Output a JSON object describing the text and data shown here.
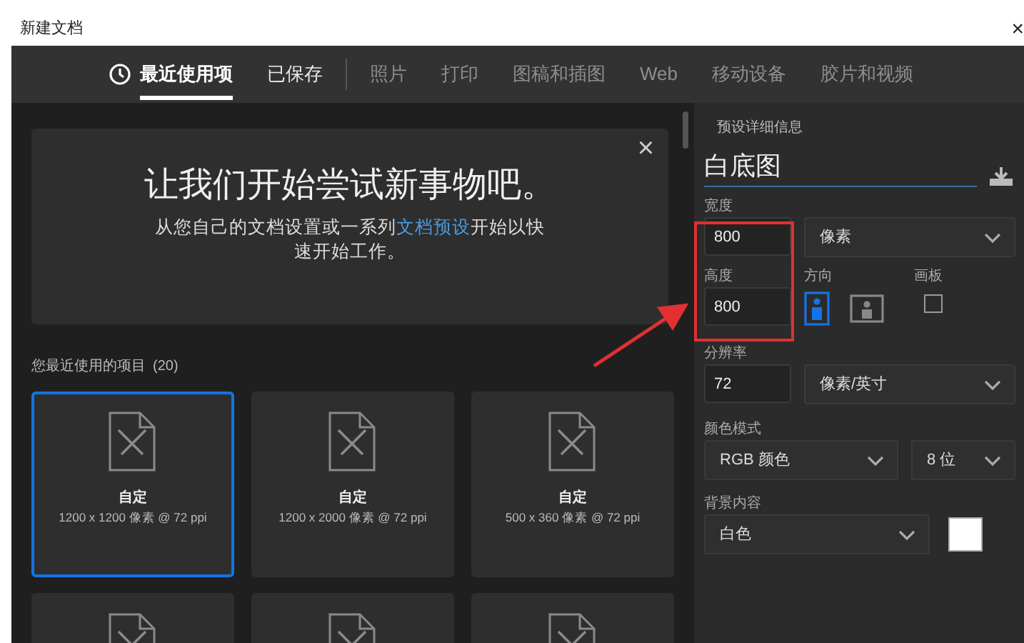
{
  "window": {
    "title": "新建文档",
    "close": "×"
  },
  "tabs": [
    {
      "label": "最近使用项",
      "selected": true,
      "clock_icon": true,
      "dimmed": false
    },
    {
      "label": "已保存",
      "selected": false,
      "clock_icon": false,
      "dimmed": false
    },
    {
      "label": "照片",
      "selected": false,
      "clock_icon": false,
      "dimmed": true
    },
    {
      "label": "打印",
      "selected": false,
      "clock_icon": false,
      "dimmed": true
    },
    {
      "label": "图稿和插图",
      "selected": false,
      "clock_icon": false,
      "dimmed": true
    },
    {
      "label": "Web",
      "selected": false,
      "clock_icon": false,
      "dimmed": true
    },
    {
      "label": "移动设备",
      "selected": false,
      "clock_icon": false,
      "dimmed": true
    },
    {
      "label": "胶片和视频",
      "selected": false,
      "clock_icon": false,
      "dimmed": true
    }
  ],
  "hero": {
    "heading": "让我们开始尝试新事物吧。",
    "text_before": "从您自己的文档设置或一系列",
    "link": "文档预设",
    "text_after": "开始以快速开始工作。",
    "close": "×"
  },
  "recent": {
    "label": "您最近使用的项目",
    "count": "(20)"
  },
  "tiles": [
    {
      "name": "自定",
      "size": "1200 x 1200 像素 @ 72 ppi",
      "selected": true
    },
    {
      "name": "自定",
      "size": "1200 x 2000 像素 @ 72 ppi",
      "selected": false
    },
    {
      "name": "自定",
      "size": "500 x 360 像素 @ 72 ppi",
      "selected": false
    },
    {
      "selected": false
    },
    {
      "selected": false
    },
    {
      "selected": false
    }
  ],
  "preset": {
    "heading": "预设详细信息",
    "name": "白底图",
    "width": {
      "label": "宽度",
      "value": "800",
      "unit": "像素"
    },
    "height": {
      "label": "高度",
      "value": "800"
    },
    "orientation": {
      "label": "方向",
      "options": [
        {
          "kind": "portrait",
          "selected": true
        },
        {
          "kind": "landscape",
          "selected": false
        }
      ]
    },
    "artboard": {
      "label": "画板",
      "checked": false
    },
    "resolution": {
      "label": "分辨率",
      "value": "72",
      "unit": "像素/英寸"
    },
    "color_mode": {
      "label": "颜色模式",
      "mode": "RGB 颜色",
      "depth": "8 位"
    },
    "background": {
      "label": "背景内容",
      "value": "白色",
      "color": "#ffffff"
    }
  },
  "annotation": {
    "highlight": true
  }
}
